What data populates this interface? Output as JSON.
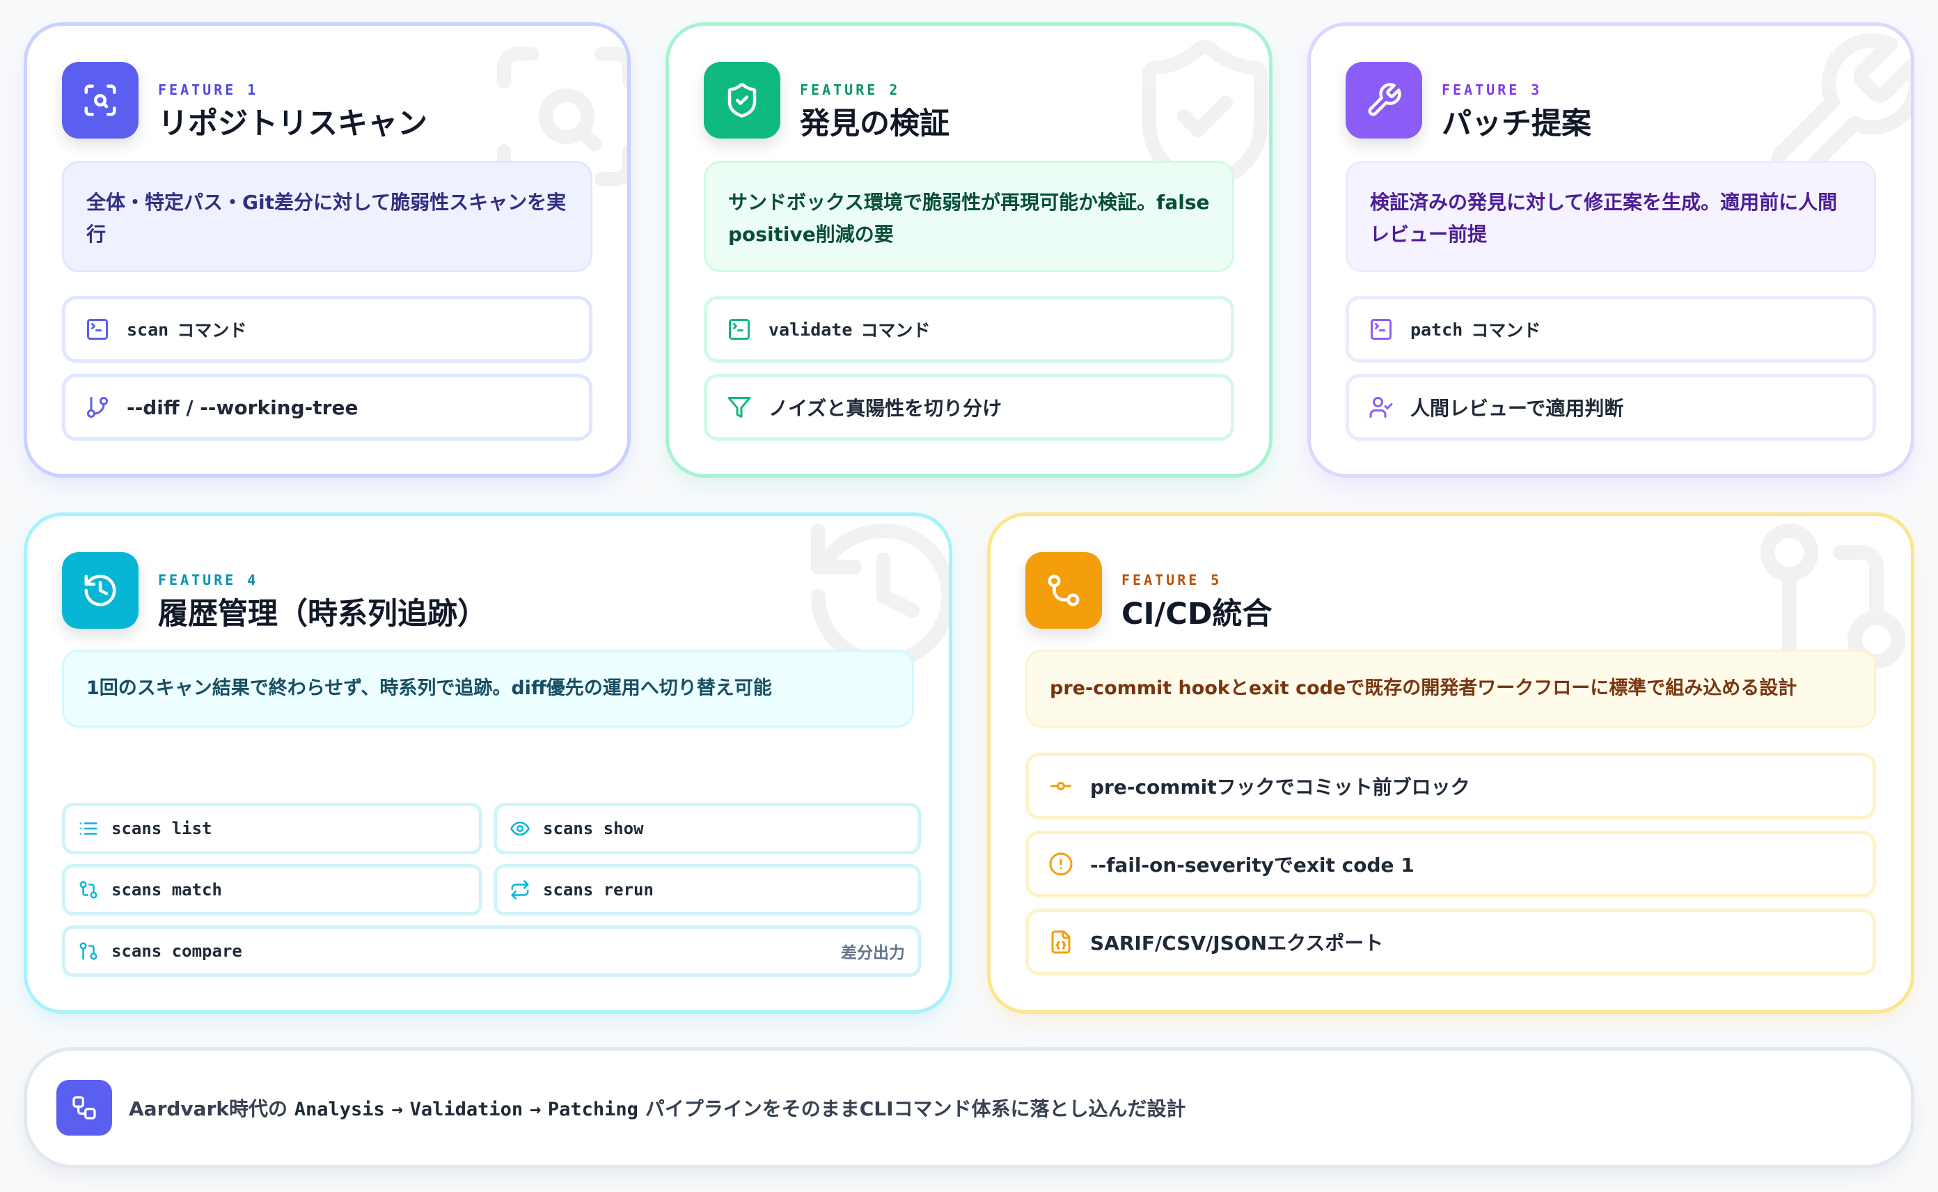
{
  "colors": {
    "indigo": "#5b5ff0",
    "emerald": "#10b981",
    "violet": "#8b5cf6",
    "cyan": "#06b6d4",
    "amber": "#f59e0b"
  },
  "features": {
    "f1": {
      "eyebrow": "FEATURE",
      "num": "1",
      "title": "リポジトリスキャン",
      "desc": "全体・特定パス・Git差分に対して脆弱性スキャンを実行",
      "items": [
        {
          "icon": "terminal-icon",
          "code": "scan",
          "label": "コマンド"
        },
        {
          "icon": "git-branch-icon",
          "label": "--diff / --working-tree"
        }
      ]
    },
    "f2": {
      "eyebrow": "FEATURE",
      "num": "2",
      "title": "発見の検証",
      "desc": "サンドボックス環境で脆弱性が再現可能か検証。false positive削減の要",
      "items": [
        {
          "icon": "terminal-icon",
          "code": "validate",
          "label": "コマンド"
        },
        {
          "icon": "filter-icon",
          "label": "ノイズと真陽性を切り分け"
        }
      ]
    },
    "f3": {
      "eyebrow": "FEATURE",
      "num": "3",
      "title": "パッチ提案",
      "desc": "検証済みの発見に対して修正案を生成。適用前に人間レビュー前提",
      "items": [
        {
          "icon": "terminal-icon",
          "code": "patch",
          "label": "コマンド"
        },
        {
          "icon": "user-check-icon",
          "label": "人間レビューで適用判断"
        }
      ]
    },
    "f4": {
      "eyebrow": "FEATURE",
      "num": "4",
      "title": "履歴管理（時系列追跡）",
      "desc": "1回のスキャン結果で終わらせず、時系列で追跡。diff優先の運用へ切り替え可能",
      "commands": [
        {
          "icon": "list-icon",
          "code": "scans list"
        },
        {
          "icon": "eye-icon",
          "code": "scans show"
        },
        {
          "icon": "git-compare-icon",
          "code": "scans match"
        },
        {
          "icon": "repeat-icon",
          "code": "scans rerun"
        },
        {
          "icon": "git-pull-request-icon",
          "code": "scans compare",
          "extra": "差分出力"
        }
      ]
    },
    "f5": {
      "eyebrow": "FEATURE",
      "num": "5",
      "title": "CI/CD統合",
      "desc": "pre-commit hookとexit codeで既存の開発者ワークフローに標準で組み込める設計",
      "items": [
        {
          "icon": "git-commit-icon",
          "label": "pre-commitフックでコミット前ブロック"
        },
        {
          "icon": "alert-circle-icon",
          "label": "--fail-on-severityでexit code 1"
        },
        {
          "icon": "file-json-icon",
          "label": "SARIF/CSV/JSONエクスポート"
        }
      ]
    }
  },
  "footer": {
    "prefix": "Aardvark時代の",
    "s1": "Analysis",
    "arrow": "→",
    "s2": "Validation",
    "s3": "Patching",
    "suffix": "パイプラインをそのままCLIコマンド体系に落とし込んだ設計"
  }
}
